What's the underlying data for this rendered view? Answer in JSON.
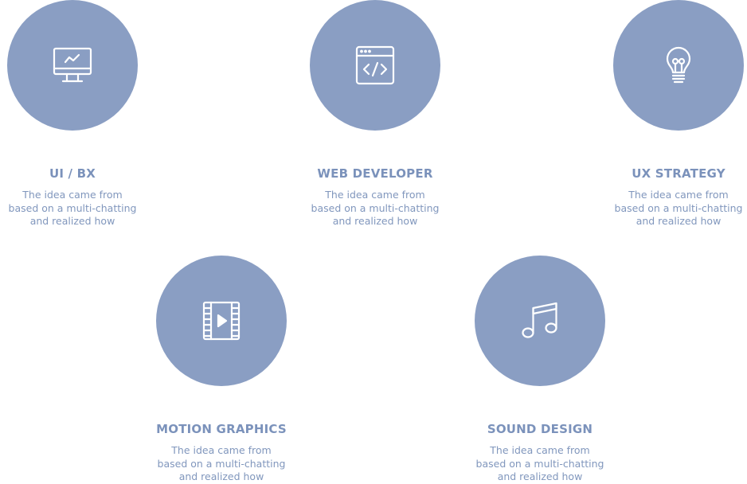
{
  "accent_color": "#8a9ec3",
  "services": [
    {
      "title": "UI / BX",
      "icon": "monitor-chart-icon",
      "desc": [
        "The idea came from",
        "based on a multi-chatting",
        "and realized how"
      ]
    },
    {
      "title": "WEB DEVELOPER",
      "icon": "browser-code-icon",
      "desc": [
        "The idea came from",
        "based on a multi-chatting",
        "and realized how"
      ]
    },
    {
      "title": "UX STRATEGY",
      "icon": "lightbulb-icon",
      "desc": [
        "The idea came from",
        "based on a multi-chatting",
        "and realized how"
      ]
    },
    {
      "title": "MOTION GRAPHICS",
      "icon": "film-play-icon",
      "desc": [
        "The idea came from",
        "based on a multi-chatting",
        "and realized how"
      ]
    },
    {
      "title": "SOUND DESIGN",
      "icon": "music-note-icon",
      "desc": [
        "The idea came from",
        "based on a multi-chatting",
        "and realized how"
      ]
    }
  ]
}
